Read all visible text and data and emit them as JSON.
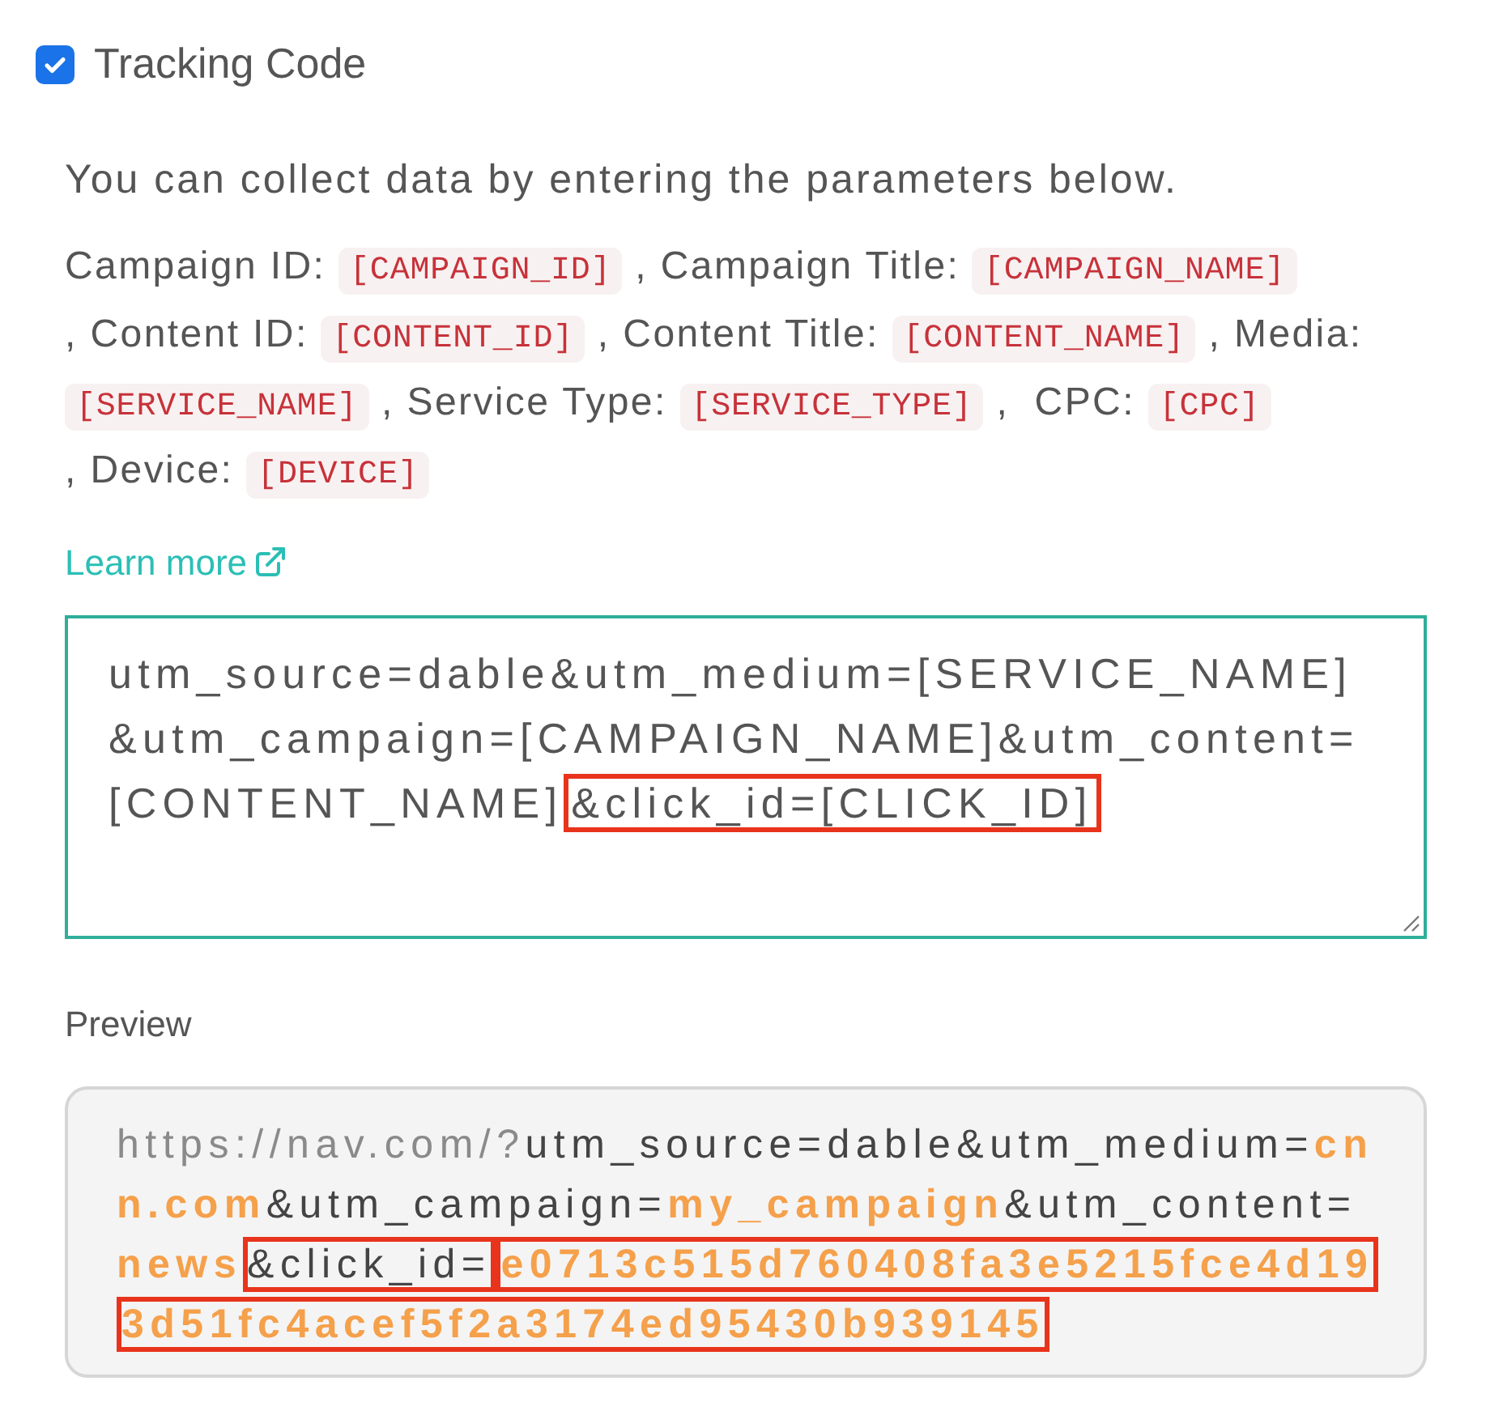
{
  "tracking": {
    "label": "Tracking Code",
    "checked": true
  },
  "description": "You can collect data by entering the parameters below.",
  "parameters": [
    {
      "label": "Campaign ID:",
      "code": "[CAMPAIGN_ID]"
    },
    {
      "label": ", Campaign Title:",
      "code": "[CAMPAIGN_NAME]"
    },
    {
      "label": ", Content ID:",
      "code": "[CONTENT_ID]"
    },
    {
      "label": ", Content Title:",
      "code": "[CONTENT_NAME]"
    },
    {
      "label": ", Media:",
      "code": "[SERVICE_NAME]"
    },
    {
      "label": ", Service Type:",
      "code": "[SERVICE_TYPE]"
    },
    {
      "label": ",  CPC:",
      "code": "[CPC]"
    },
    {
      "label": ", Device:",
      "code": "[DEVICE]"
    }
  ],
  "learn_more": "Learn more",
  "tracking_field": {
    "segments": [
      {
        "text": "utm_source=dable&utm_medium=[SERVICE_NAME]&utm_campaign=[CAMPAIGN_NAME]&utm_content=[CONTENT_NAME]",
        "highlighted": false
      },
      {
        "text": "&click_id=[CLICK_ID]",
        "highlighted": true
      }
    ]
  },
  "preview": {
    "label": "Preview",
    "segments": [
      {
        "text": "https://nav.com/?",
        "kind": "host",
        "highlighted": false
      },
      {
        "text": "utm_source=dable&utm_medium=",
        "kind": "plain",
        "highlighted": false
      },
      {
        "text": "cnn.com",
        "kind": "value",
        "highlighted": false
      },
      {
        "text": "&utm_campaign=",
        "kind": "plain",
        "highlighted": false
      },
      {
        "text": "my_campaign",
        "kind": "value",
        "highlighted": false
      },
      {
        "text": "&utm_content=",
        "kind": "plain",
        "highlighted": false
      },
      {
        "text": "news",
        "kind": "value",
        "highlighted": false
      },
      {
        "text": "&click_id=",
        "kind": "plain",
        "highlighted": true
      },
      {
        "text": "e0713c515d760408fa3e5215fce4d193d51fc4acef5f2a3174ed95430b939145",
        "kind": "value",
        "highlighted": true
      }
    ]
  }
}
